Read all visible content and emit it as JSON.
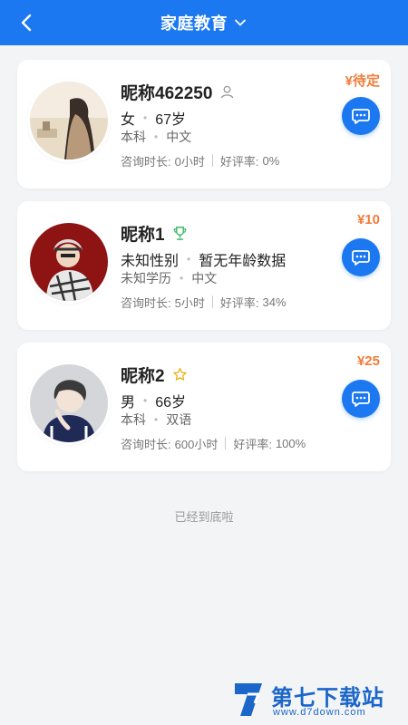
{
  "header": {
    "title": "家庭教育"
  },
  "counselors": [
    {
      "name": "昵称462250",
      "badge_icon": "person-outline-icon",
      "gender": "女",
      "age": "67岁",
      "education": "本科",
      "language": "中文",
      "duration_label": "咨询时长:",
      "duration": "0小时",
      "rating_label": "好评率:",
      "rating": "0%",
      "price": "¥待定"
    },
    {
      "name": "昵称1",
      "badge_icon": "trophy-icon",
      "gender": "未知性别",
      "age": "暂无年龄数据",
      "education": "未知学历",
      "language": "中文",
      "duration_label": "咨询时长:",
      "duration": "5小时",
      "rating_label": "好评率:",
      "rating": "34%",
      "price": "¥10"
    },
    {
      "name": "昵称2",
      "badge_icon": "star-icon",
      "gender": "男",
      "age": "66岁",
      "education": "本科",
      "language": "双语",
      "duration_label": "咨询时长:",
      "duration": "600小时",
      "rating_label": "好评率:",
      "rating": "100%",
      "price": "¥25"
    }
  ],
  "footer": {
    "end_text": "已经到底啦"
  },
  "watermark": {
    "text": "第七下载站",
    "url": "www.d7down.com"
  },
  "colors": {
    "accent": "#1b78f0",
    "price": "#f07c3a"
  }
}
